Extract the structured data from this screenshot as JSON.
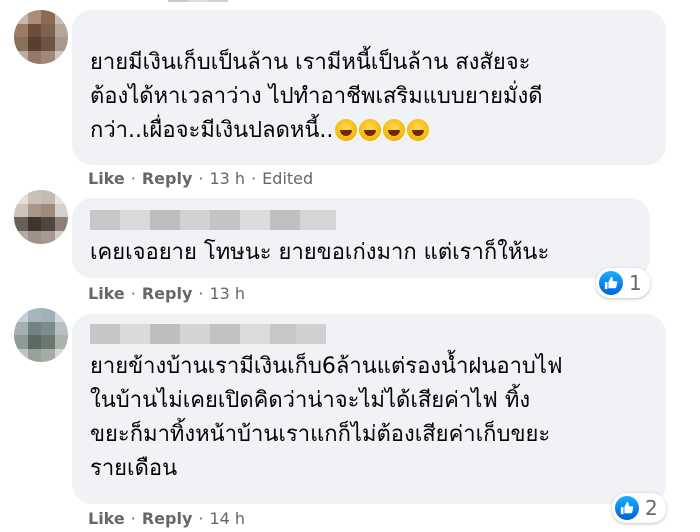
{
  "comments": [
    {
      "lines": [
        "ยายมีเงินเก็บเป็นล้าน เรามีหนี้เป็นล้าน สงสัยจะ",
        "ต้องได้หาเวลาว่าง ไปทำอาชีพเสริมแบบยายมั่งดี",
        "กว่า..เผื่อจะมีเงินปลดหนี้.."
      ],
      "emoji": [
        "rolling-laughing-emoji",
        "rolling-laughing-emoji",
        "rolling-laughing-emoji",
        "rolling-laughing-emoji"
      ],
      "like": "Like",
      "reply": "Reply",
      "time": "13 h",
      "edited": "Edited"
    },
    {
      "lines": [
        "เคยเจอยาย โทษนะ ยายขอเก่งมาก แต่เราก็ให้นะ"
      ],
      "like": "Like",
      "reply": "Reply",
      "time": "13 h",
      "reactions": "1"
    },
    {
      "lines": [
        "ยายข้างบ้านเรามีเงินเก็บ6ล้านแต่รองน้ำฝนอาบไฟ",
        "ในบ้านไม่เคยเปิดคิดว่าน่าจะไม่ได้เสียค่าไฟ ทิ้ง",
        "ขยะก็มาทิ้งหน้าบ้านเราแกก็ไม่ต้องเสียค่าเก็บขยะ",
        "รายเดือน"
      ],
      "like": "Like",
      "reply": "Reply",
      "time": "14 h",
      "reactions": "2"
    }
  ],
  "separator": "·",
  "colors": {
    "bubble": "#f0f2f5",
    "meta": "#65676b",
    "like_blue": "#0866ff"
  }
}
